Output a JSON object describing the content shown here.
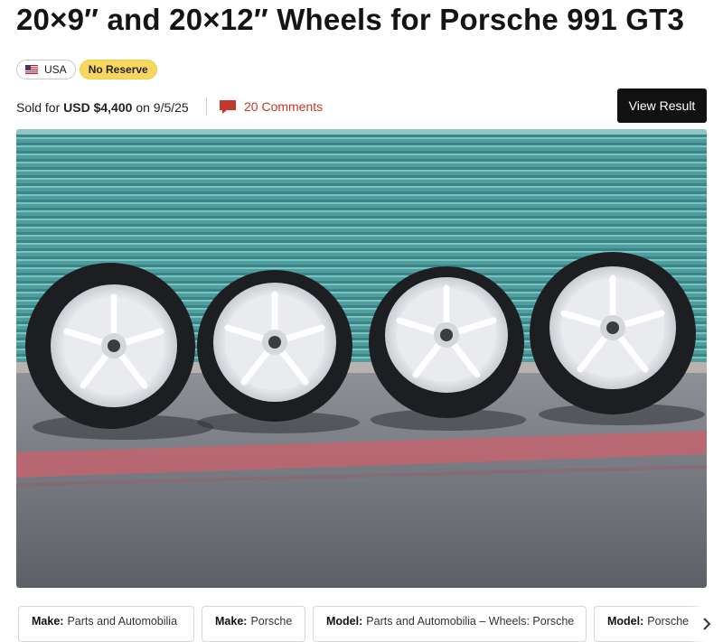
{
  "listing": {
    "title": "20×9″ and 20×12″ Wheels for Porsche 991 GT3",
    "tags": {
      "country_label": "USA",
      "country_flag_icon": "us-flag-icon",
      "reserve_label": "No Reserve"
    },
    "result": {
      "prefix": "Sold for",
      "amount": "USD $4,400",
      "on_word": "on",
      "date": "9/5/25",
      "comments_label": "20 Comments",
      "comments_icon": "comment-bubble-icon",
      "view_button_label": "View Result"
    }
  },
  "facts": [
    {
      "key": "Make:",
      "value": "Parts and Automobilia"
    },
    {
      "key": "Make:",
      "value": "Porsche"
    },
    {
      "key": "Model:",
      "value": "Parts and Automobilia – Wheels: Porsche"
    },
    {
      "key": "Model:",
      "value": "Porsche"
    }
  ],
  "colors": {
    "accent_red": "#c0392b",
    "no_reserve_yellow": "#f7d760",
    "button_black": "#111111"
  }
}
